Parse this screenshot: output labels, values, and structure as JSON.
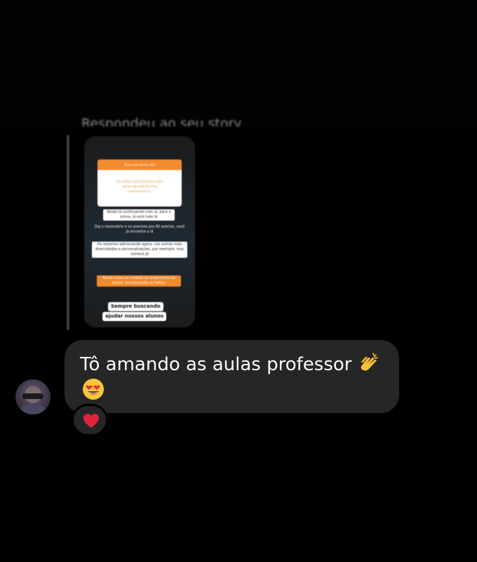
{
  "conversation": {
    "story_reply_label": "Respondeu ao seu story",
    "story_preview": {
      "question_header": "Deixe sua dúvida aqui",
      "question_text": "Os estão adicionando mais aulas da plataforma matemática?",
      "answer_line_1": "Ainda tá continuando com aí, para a prova, já está tudo lá",
      "answer_line_2": "Daj o necessário e os precisos pra 60 acertos, você já encontra a lá",
      "answer_line_3": "Ou estamos adicionando agora, nas outras mais diversidades e personalizações, por exemplo, mas comece já",
      "answer_line_4": "Nosso curso se modela no andamento da prova, incorporando as falhas",
      "closing_line_1": "Sempre buscando",
      "closing_line_2": "ajudar nossos alunos"
    },
    "message": {
      "text": "Tô amando as aulas professor",
      "emoji_1": "clap-icon",
      "emoji_2": "heart-eyes-icon"
    },
    "reaction": {
      "emoji": "heart-icon",
      "color": "#e0243c"
    },
    "colors": {
      "bubble": "#262626",
      "background": "#000000",
      "story_accent": "#f28a2e"
    }
  }
}
